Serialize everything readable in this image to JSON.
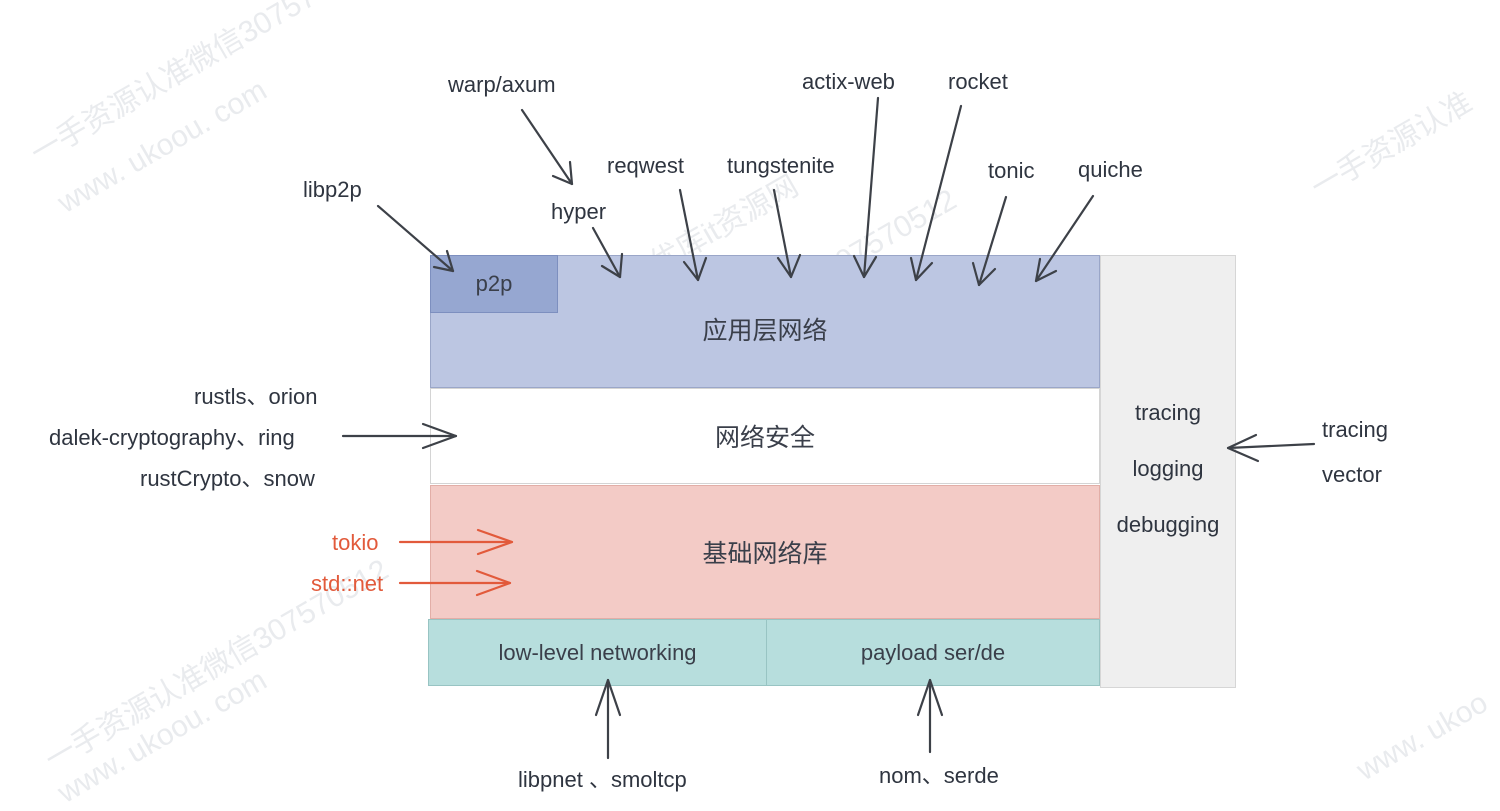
{
  "layers": {
    "app": "应用层网络",
    "p2p": "p2p",
    "security": "网络安全",
    "base": "基础网络库",
    "lowlevel": "low-level networking",
    "payload": "payload ser/de"
  },
  "side_panel": {
    "items": [
      "tracing",
      "logging",
      "debugging"
    ]
  },
  "labels": {
    "warp_axum": "warp/axum",
    "actix_web": "actix-web",
    "rocket": "rocket",
    "reqwest": "reqwest",
    "tungstenite": "tungstenite",
    "tonic": "tonic",
    "quiche": "quiche",
    "hyper": "hyper",
    "libp2p": "libp2p",
    "sec1": "rustls、orion",
    "sec2": "dalek-cryptography、ring",
    "sec3": "rustCrypto、snow",
    "tokio": "tokio",
    "stdnet": "std::net",
    "tracing_right": "tracing",
    "vector_right": "vector",
    "libpnet": "libpnet 、smoltcp",
    "nom_serde": "nom、serde"
  },
  "watermarks": [
    "一手资源认准微信30757",
    "www. ukoou. com",
    "优库it资源网",
    "认准微信307570512",
    "一手资源认准微信307570512",
    "www. ukoou. com",
    "一手资源认准",
    "www. ukoo"
  ],
  "colors": {
    "app": "#bcc6e2",
    "p2p": "#96a7d1",
    "security": "#ffffff",
    "base": "#f3cbc6",
    "network": "#b7dedd",
    "side": "#efefef",
    "arrow": "#3d4148",
    "arrow_red": "#e25a3b"
  }
}
